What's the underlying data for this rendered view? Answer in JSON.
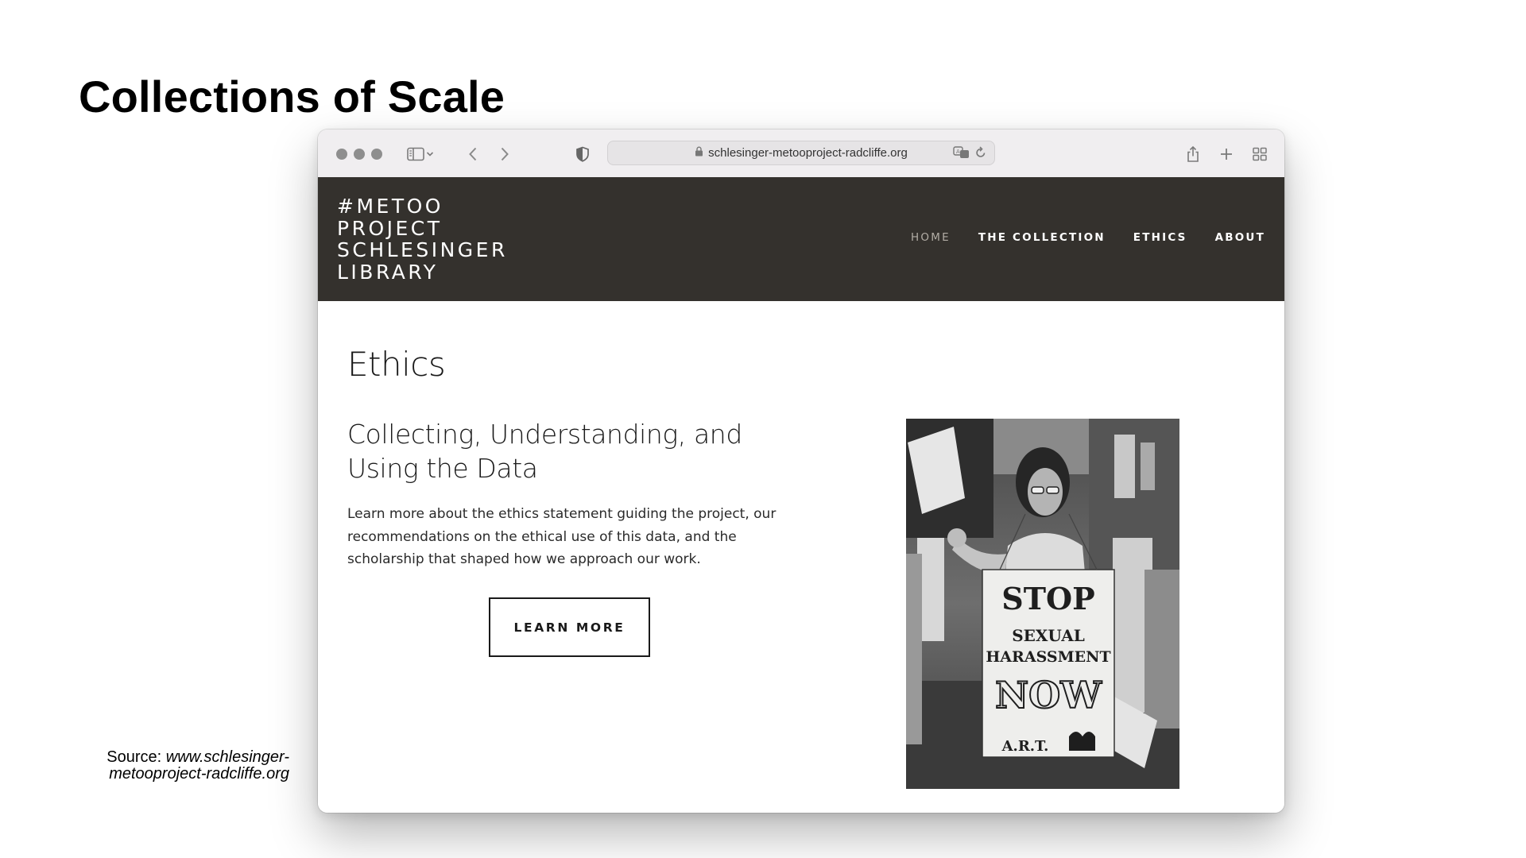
{
  "slide": {
    "title": "Collections of Scale",
    "source_label": "Source:",
    "source_url": "www.schlesinger-metooproject-radcliffe.org"
  },
  "browser": {
    "url": "schlesinger-metooproject-radcliffe.org",
    "icons": [
      "traffic-lights",
      "sidebar-icon",
      "chevron-down-icon",
      "back-icon",
      "forward-icon",
      "privacy-shield-icon",
      "lock-icon",
      "translate-icon",
      "reload-icon",
      "share-icon",
      "new-tab-icon",
      "tab-overview-icon"
    ]
  },
  "site": {
    "logo_lines": [
      "#METOO",
      "PROJECT",
      "SCHLESINGER",
      "LIBRARY"
    ],
    "nav": [
      {
        "label": "HOME",
        "active": true
      },
      {
        "label": "THE COLLECTION",
        "active": false
      },
      {
        "label": "ETHICS",
        "active": false
      },
      {
        "label": "ABOUT",
        "active": false
      }
    ],
    "header_color": "#34312d"
  },
  "page": {
    "heading": "Ethics",
    "subheading": "Collecting, Understanding, and Using the Data",
    "body": "Learn more about the ethics statement guiding the project, our recommendations on the ethical use of this data, and the scholarship that shaped how we approach our work.",
    "button_label": "LEARN MORE"
  },
  "photo": {
    "sign_lines": [
      "STOP",
      "SEXUAL",
      "HARASSMENT",
      "NOW",
      "A.R.T."
    ]
  }
}
